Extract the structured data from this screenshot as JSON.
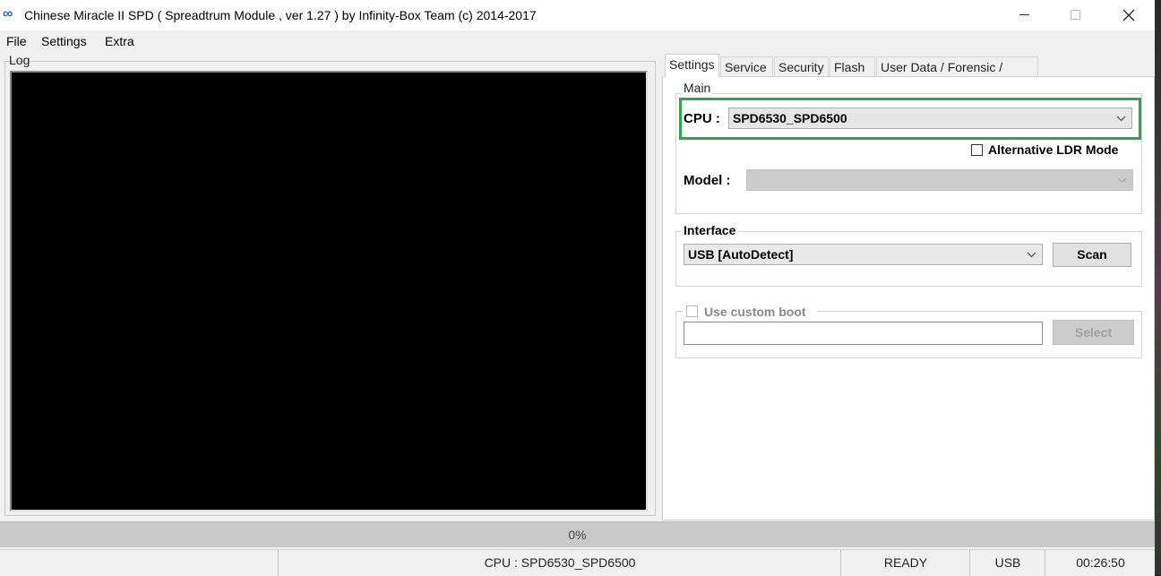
{
  "window": {
    "title": "Chinese Miracle II SPD ( Spreadtrum Module , ver 1.27 ) by Infinity-Box Team (c) 2014-2017",
    "icon": "infinity-logo-icon",
    "controls": {
      "minimize": "—",
      "maximize": "☐",
      "close": "✕"
    }
  },
  "menu": {
    "items": [
      "File",
      "Settings",
      "Extra"
    ]
  },
  "log": {
    "label": "Log"
  },
  "tabs": [
    "Settings",
    "Service",
    "Security",
    "Flash",
    "User Data / Forensic / Other"
  ],
  "settings": {
    "main": {
      "title": "Main",
      "cpu_label": "CPU :",
      "cpu_value": "SPD6530_SPD6500",
      "alt_ldr_label": "Alternative LDR Mode",
      "alt_ldr_checked": false,
      "model_label": "Model :",
      "model_value": ""
    },
    "interface": {
      "title": "Interface",
      "value": "USB [AutoDetect]",
      "scan_label": "Scan"
    },
    "custom_boot": {
      "label": "Use custom boot",
      "checked": false,
      "path_value": "",
      "select_label": "Select"
    }
  },
  "progress": {
    "text": "0%",
    "value": 0
  },
  "status": {
    "cpu": "CPU : SPD6530_SPD6500",
    "state": "READY",
    "interface": "USB",
    "time": "00:26:50"
  },
  "colors": {
    "highlight": "#2da44e",
    "log_background": "#000000"
  }
}
